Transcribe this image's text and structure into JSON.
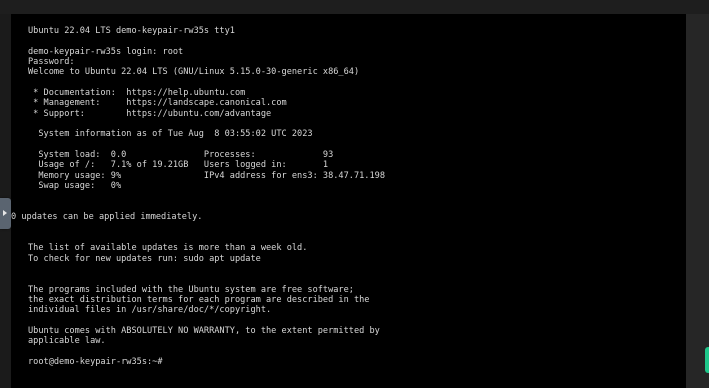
{
  "terminal": {
    "lines": [
      "Ubuntu 22.04 LTS demo-keypair-rw35s tty1",
      "",
      "demo-keypair-rw35s login: root",
      "Password:",
      "Welcome to Ubuntu 22.04 LTS (GNU/Linux 5.15.0-30-generic x86_64)",
      "",
      " * Documentation:  https://help.ubuntu.com",
      " * Management:     https://landscape.canonical.com",
      " * Support:        https://ubuntu.com/advantage",
      "",
      "  System information as of Tue Aug  8 03:55:02 UTC 2023",
      "",
      "  System load:  0.0               Processes:             93",
      "  Usage of /:   7.1% of 19.21GB   Users logged in:       1",
      "  Memory usage: 9%                IPv4 address for ens3: 38.47.71.198",
      "  Swap usage:   0%",
      "",
      "",
      "0 updates can be applied immediately.",
      "",
      "",
      "The list of available updates is more than a week old.",
      "To check for new updates run: sudo apt update",
      "",
      "",
      "The programs included with the Ubuntu system are free software;",
      "the exact distribution terms for each program are described in the",
      "individual files in /usr/share/doc/*/copyright.",
      "",
      "Ubuntu comes with ABSOLUTELY NO WARRANTY, to the extent permitted by",
      "applicable law.",
      "",
      "root@demo-keypair-rw35s:~#"
    ]
  }
}
